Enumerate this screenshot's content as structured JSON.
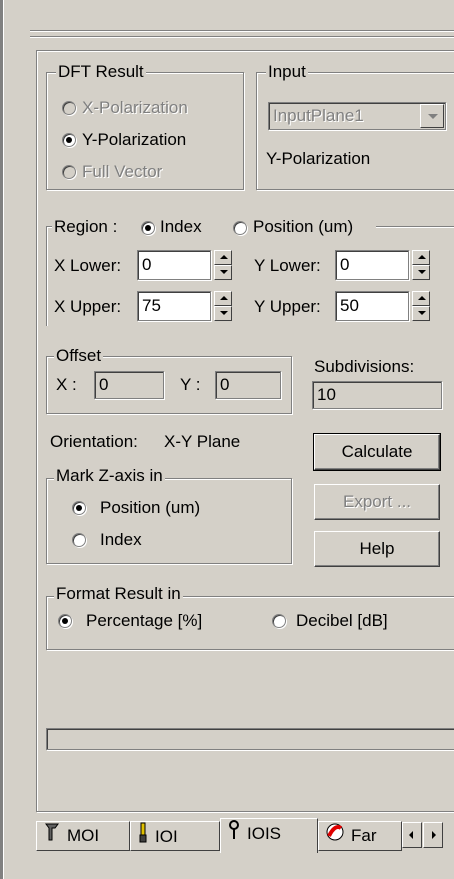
{
  "dft_result": {
    "legend": "DFT Result",
    "options": [
      "X-Polarization",
      "Y-Polarization",
      "Full Vector"
    ],
    "selected": "Y-Polarization"
  },
  "input": {
    "legend": "Input",
    "plane_value": "InputPlane1",
    "polarization_text": "Y-Polarization"
  },
  "region": {
    "legend": "Region :",
    "options": [
      "Index",
      "Position (um)"
    ],
    "selected": "Index",
    "x_lower_label": "X Lower:",
    "x_lower_value": "0",
    "y_lower_label": "Y Lower:",
    "y_lower_value": "0",
    "x_upper_label": "X Upper:",
    "x_upper_value": "75",
    "y_upper_label": "Y Upper:",
    "y_upper_value": "50"
  },
  "offset": {
    "legend": "Offset",
    "x_label": "X :",
    "x_value": "0",
    "y_label": "Y :",
    "y_value": "0"
  },
  "subdivisions": {
    "label": "Subdivisions:",
    "value": "10"
  },
  "orientation": {
    "label": "Orientation:",
    "value": "X-Y Plane"
  },
  "mark_z_axis": {
    "legend": "Mark Z-axis in",
    "options": [
      "Position (um)",
      "Index"
    ],
    "selected": "Position (um)"
  },
  "buttons": {
    "calculate": "Calculate",
    "export": "Export ...",
    "help": "Help"
  },
  "format_result": {
    "legend": "Format Result in",
    "options": [
      "Percentage [%]",
      "Decibel [dB]"
    ],
    "selected": "Percentage [%]"
  },
  "tabs": {
    "items": [
      "MOI",
      "IOI",
      "IOIS",
      "Far"
    ],
    "active": "IOIS",
    "icons": [
      "tool-icon",
      "probe-icon",
      "pin-icon",
      "far-field-icon"
    ]
  },
  "colors": {
    "face": "#d4d0c8",
    "shadow": "#808080",
    "highlight": "#ffffff",
    "disabled_text": "#808080"
  }
}
